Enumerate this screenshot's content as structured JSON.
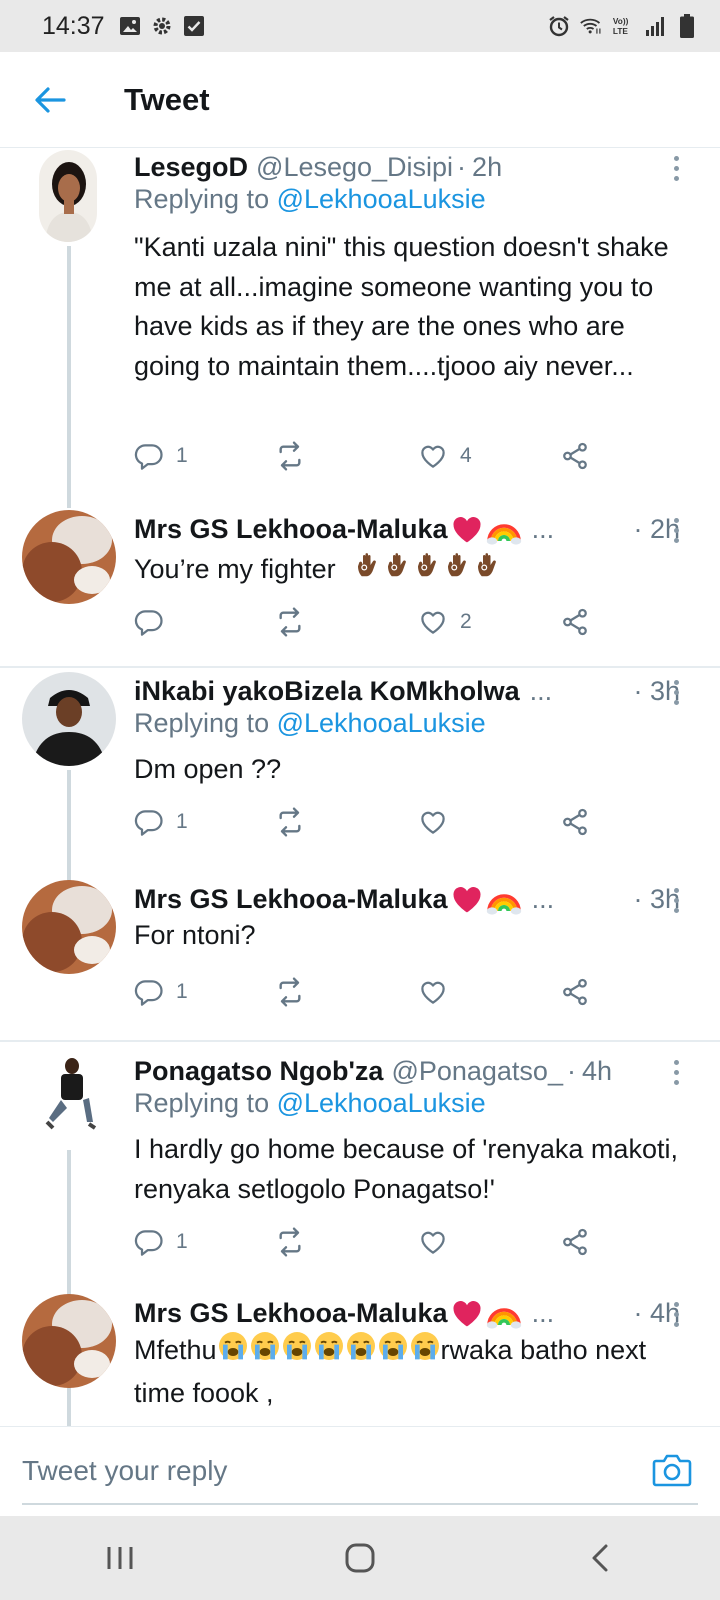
{
  "status_bar": {
    "time": "14:37"
  },
  "header": {
    "title": "Tweet",
    "back_icon": "arrow-left-icon"
  },
  "tweets": [
    {
      "name": "LesegoD",
      "handle": "@Lesego_Disipi",
      "time": "2h",
      "replying_to_prefix": "Replying to",
      "replying_to": "@LekhooaLuksie",
      "text": "\"Kanti uzala nini\" this question doesn't shake me at all...imagine someone wanting you to have kids as if they are the ones who are going to maintain them....tjooo aiy never...",
      "reply_count": "1",
      "like_count": "4"
    },
    {
      "name": "Mrs GS Lekhooa-Maluka",
      "name_emojis": [
        "red-heart",
        "rainbow"
      ],
      "ellipsis": "...",
      "time": "· 2h",
      "text": "You’re my fighter",
      "text_emojis": [
        "ok-hand",
        "ok-hand",
        "ok-hand",
        "ok-hand",
        "ok-hand"
      ],
      "reply_count": "",
      "like_count": "2"
    },
    {
      "name": "iNkabi yakoBizela KoMkholwa",
      "ellipsis": "...",
      "time": "· 3h",
      "replying_to_prefix": "Replying to",
      "replying_to": "@LekhooaLuksie",
      "text": "Dm open ??",
      "reply_count": "1",
      "like_count": ""
    },
    {
      "name": "Mrs GS Lekhooa-Maluka",
      "name_emojis": [
        "red-heart",
        "rainbow"
      ],
      "ellipsis": "...",
      "time": "· 3h",
      "text": "For ntoni?",
      "reply_count": "1",
      "like_count": ""
    },
    {
      "name": "Ponagatso Ngob'za",
      "handle": "@Ponagatso_",
      "time": "4h",
      "replying_to_prefix": "Replying to",
      "replying_to": "@LekhooaLuksie",
      "text": "I hardly go home because of 'renyaka makoti, renyaka setlogolo Ponagatso!'",
      "reply_count": "1",
      "like_count": ""
    },
    {
      "name": "Mrs GS Lekhooa-Maluka",
      "name_emojis": [
        "red-heart",
        "rainbow"
      ],
      "ellipsis": "...",
      "time": "· 4h",
      "text_prefix": "Mfethu",
      "text_emojis": [
        "crying-face",
        "crying-face",
        "crying-face",
        "crying-face",
        "crying-face",
        "crying-face",
        "crying-face"
      ],
      "text_suffix": "rwaka batho next time foook ,"
    }
  ],
  "reply_bar": {
    "placeholder": "Tweet your reply",
    "camera_icon": "camera-icon"
  },
  "nav_bar": {
    "icons": [
      "recent-apps-icon",
      "home-icon",
      "back-icon"
    ]
  },
  "colors": {
    "accent": "#1b95e0",
    "muted": "#657786",
    "text": "#14171a",
    "divider": "#e6ecf0"
  }
}
